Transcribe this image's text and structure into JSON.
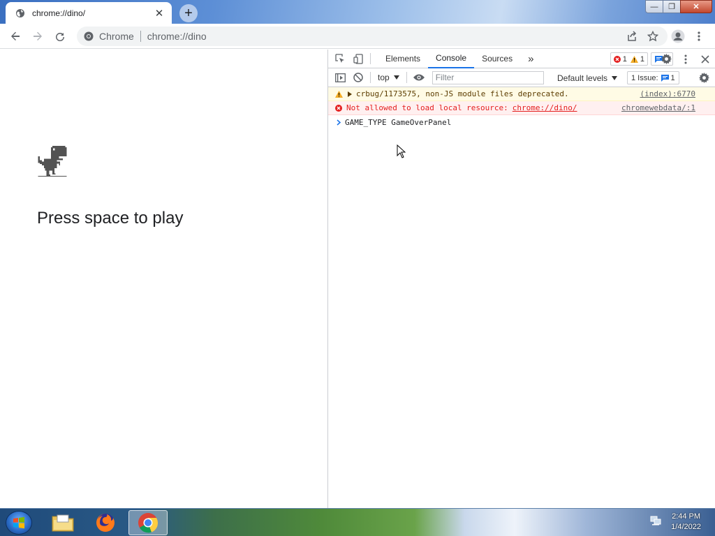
{
  "browser": {
    "tab_title": "chrome://dino/",
    "new_tab_symbol": "+",
    "tab_close_symbol": "✕",
    "omnibox": {
      "site_label": "Chrome",
      "url": "chrome://dino"
    }
  },
  "window_controls": {
    "minimize": "—",
    "maximize": "❐",
    "close": "✕"
  },
  "page": {
    "message": "Press space to play"
  },
  "devtools": {
    "tabs": [
      {
        "label": "Elements",
        "active": false
      },
      {
        "label": "Console",
        "active": true
      },
      {
        "label": "Sources",
        "active": false
      }
    ],
    "more_tabs": "»",
    "counts": {
      "errors": "1",
      "warnings": "1",
      "messages": "1"
    },
    "toolbar": {
      "context": "top",
      "filter_placeholder": "Filter",
      "levels": "Default levels",
      "issues_label": "1 Issue:",
      "issues_count": "1"
    },
    "console": {
      "warning": {
        "text": "crbug/1173575, non-JS module files deprecated.",
        "source": "(index):6770"
      },
      "error": {
        "text": "Not allowed to load local resource:",
        "link": "chrome://dino/",
        "source": "chromewebdata/:1"
      },
      "input": {
        "text": "GAME_TYPE GameOverPanel"
      }
    }
  },
  "taskbar": {
    "time": "2:44 PM",
    "date": "1/4/2022"
  },
  "colors": {
    "accent": "#1a73e8",
    "error": "#e41e1e",
    "warning_bg": "#fffbe5",
    "error_bg": "#fff0f0"
  }
}
